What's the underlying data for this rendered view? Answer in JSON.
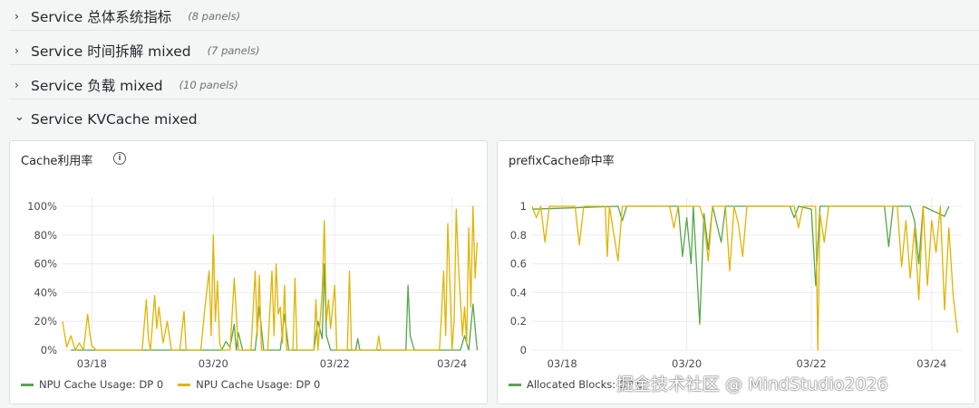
{
  "rows": [
    {
      "title": "Service 总体系统指标",
      "count": "(8 panels)",
      "expanded": false
    },
    {
      "title": "Service 时间拆解 mixed",
      "count": "(7 panels)",
      "expanded": false
    },
    {
      "title": "Service 负载 mixed",
      "count": "(10 panels)",
      "expanded": false
    },
    {
      "title": "Service KVCache mixed",
      "count": "",
      "expanded": true
    }
  ],
  "icons": {
    "collapsed": "chevron-right-icon",
    "expanded": "chevron-down-icon",
    "info": "info-icon"
  },
  "chevrons": {
    "collapsed": "›",
    "expanded": "⌄"
  },
  "colors": {
    "green": "#56a64b",
    "yellow": "#e0b400",
    "grid": "#ececec",
    "axis": "#464c54"
  },
  "panels": [
    {
      "title": "Cache利用率",
      "legend": [
        "NPU Cache Usage: DP 0",
        "NPU Cache Usage: DP 0"
      ]
    },
    {
      "title": "prefixCache命中率",
      "legend": [
        "Allocated Blocks: DP 0"
      ]
    }
  ],
  "chart_data": [
    {
      "type": "line",
      "title": "Cache利用率",
      "x_ticks": [
        "03/18",
        "03/20",
        "03/22",
        "03/24"
      ],
      "y_ticks": [
        "0%",
        "20%",
        "40%",
        "60%",
        "80%",
        "100%"
      ],
      "ylim": [
        0,
        100
      ],
      "grid": true,
      "legend_position": "bottom-left",
      "series": [
        {
          "name": "NPU Cache Usage: DP 0",
          "color": "#56a64b",
          "points": [
            [
              0.02,
              0
            ],
            [
              0.38,
              0
            ],
            [
              0.39,
              6
            ],
            [
              0.4,
              2
            ],
            [
              0.41,
              18
            ],
            [
              0.415,
              0
            ],
            [
              0.42,
              12
            ],
            [
              0.43,
              0
            ],
            [
              0.46,
              0
            ],
            [
              0.47,
              30
            ],
            [
              0.48,
              0
            ],
            [
              0.52,
              0
            ],
            [
              0.53,
              25
            ],
            [
              0.54,
              0
            ],
            [
              0.6,
              0
            ],
            [
              0.61,
              20
            ],
            [
              0.62,
              8
            ],
            [
              0.625,
              60
            ],
            [
              0.63,
              10
            ],
            [
              0.64,
              0
            ],
            [
              0.7,
              0
            ],
            [
              0.705,
              8
            ],
            [
              0.71,
              0
            ],
            [
              0.82,
              0
            ],
            [
              0.825,
              45
            ],
            [
              0.83,
              10
            ],
            [
              0.84,
              0
            ],
            [
              0.95,
              0
            ],
            [
              0.96,
              10
            ],
            [
              0.97,
              0
            ],
            [
              0.98,
              32
            ],
            [
              0.99,
              0
            ]
          ]
        },
        {
          "name": "NPU Cache Usage: DP 0",
          "color": "#e0b400",
          "points": [
            [
              0.0,
              20
            ],
            [
              0.01,
              2
            ],
            [
              0.02,
              10
            ],
            [
              0.03,
              0
            ],
            [
              0.04,
              5
            ],
            [
              0.05,
              0
            ],
            [
              0.06,
              25
            ],
            [
              0.065,
              12
            ],
            [
              0.07,
              3
            ],
            [
              0.08,
              0
            ],
            [
              0.19,
              0
            ],
            [
              0.2,
              35
            ],
            [
              0.205,
              8
            ],
            [
              0.21,
              0
            ],
            [
              0.22,
              38
            ],
            [
              0.225,
              15
            ],
            [
              0.23,
              30
            ],
            [
              0.24,
              5
            ],
            [
              0.25,
              20
            ],
            [
              0.26,
              0
            ],
            [
              0.28,
              0
            ],
            [
              0.29,
              27
            ],
            [
              0.295,
              0
            ],
            [
              0.33,
              0
            ],
            [
              0.34,
              30
            ],
            [
              0.35,
              55
            ],
            [
              0.355,
              10
            ],
            [
              0.36,
              80
            ],
            [
              0.365,
              20
            ],
            [
              0.37,
              48
            ],
            [
              0.375,
              5
            ],
            [
              0.38,
              0
            ],
            [
              0.4,
              0
            ],
            [
              0.41,
              50
            ],
            [
              0.42,
              0
            ],
            [
              0.45,
              0
            ],
            [
              0.46,
              55
            ],
            [
              0.465,
              10
            ],
            [
              0.47,
              52
            ],
            [
              0.475,
              0
            ],
            [
              0.49,
              0
            ],
            [
              0.5,
              55
            ],
            [
              0.505,
              10
            ],
            [
              0.51,
              60
            ],
            [
              0.515,
              25
            ],
            [
              0.52,
              30
            ],
            [
              0.525,
              5
            ],
            [
              0.53,
              45
            ],
            [
              0.535,
              0
            ],
            [
              0.55,
              0
            ],
            [
              0.555,
              50
            ],
            [
              0.56,
              0
            ],
            [
              0.6,
              0
            ],
            [
              0.605,
              35
            ],
            [
              0.61,
              0
            ],
            [
              0.62,
              40
            ],
            [
              0.625,
              90
            ],
            [
              0.63,
              20
            ],
            [
              0.635,
              35
            ],
            [
              0.64,
              15
            ],
            [
              0.65,
              45
            ],
            [
              0.655,
              0
            ],
            [
              0.68,
              0
            ],
            [
              0.685,
              55
            ],
            [
              0.69,
              0
            ],
            [
              0.75,
              0
            ],
            [
              0.755,
              10
            ],
            [
              0.76,
              0
            ],
            [
              0.9,
              0
            ],
            [
              0.905,
              25
            ],
            [
              0.91,
              55
            ],
            [
              0.915,
              10
            ],
            [
              0.92,
              88
            ],
            [
              0.925,
              45
            ],
            [
              0.93,
              0
            ],
            [
              0.935,
              20
            ],
            [
              0.94,
              98
            ],
            [
              0.945,
              60
            ],
            [
              0.95,
              35
            ],
            [
              0.955,
              10
            ],
            [
              0.96,
              30
            ],
            [
              0.965,
              5
            ],
            [
              0.97,
              85
            ],
            [
              0.975,
              30
            ],
            [
              0.98,
              100
            ],
            [
              0.985,
              50
            ],
            [
              0.99,
              75
            ]
          ]
        }
      ]
    },
    {
      "type": "line",
      "title": "prefixCache命中率",
      "x_ticks": [
        "03/18",
        "03/20",
        "03/22",
        "03/24"
      ],
      "y_ticks": [
        "0",
        "0.2",
        "0.4",
        "0.6",
        "0.8",
        "1"
      ],
      "ylim": [
        0,
        1
      ],
      "grid": true,
      "legend_position": "bottom-left",
      "series": [
        {
          "name": "Allocated Blocks: DP 0",
          "color": "#56a64b",
          "points": [
            [
              0.0,
              0.98
            ],
            [
              0.2,
              1.0
            ],
            [
              0.21,
              0.9
            ],
            [
              0.22,
              1.0
            ],
            [
              0.34,
              1.0
            ],
            [
              0.35,
              0.65
            ],
            [
              0.36,
              0.92
            ],
            [
              0.37,
              0.6
            ],
            [
              0.375,
              1.0
            ],
            [
              0.39,
              0.18
            ],
            [
              0.4,
              0.95
            ],
            [
              0.41,
              0.7
            ],
            [
              0.42,
              1.0
            ],
            [
              0.44,
              0.75
            ],
            [
              0.45,
              1.0
            ],
            [
              0.6,
              1.0
            ],
            [
              0.61,
              0.92
            ],
            [
              0.62,
              1.0
            ],
            [
              0.65,
              0.98
            ],
            [
              0.66,
              0.45
            ],
            [
              0.67,
              1.0
            ],
            [
              0.82,
              1.0
            ],
            [
              0.83,
              0.72
            ],
            [
              0.84,
              1.0
            ],
            [
              0.88,
              1.0
            ],
            [
              0.89,
              0.9
            ],
            [
              0.9,
              0.6
            ],
            [
              0.91,
              1.0
            ],
            [
              0.96,
              0.93
            ],
            [
              0.97,
              1.0
            ]
          ]
        },
        {
          "name": "",
          "color": "#e0b400",
          "points": [
            [
              0.0,
              1.0
            ],
            [
              0.01,
              0.92
            ],
            [
              0.02,
              1.0
            ],
            [
              0.03,
              0.75
            ],
            [
              0.04,
              1.0
            ],
            [
              0.1,
              1.0
            ],
            [
              0.11,
              0.73
            ],
            [
              0.12,
              1.0
            ],
            [
              0.17,
              1.0
            ],
            [
              0.175,
              0.65
            ],
            [
              0.18,
              1.0
            ],
            [
              0.2,
              0.62
            ],
            [
              0.21,
              1.0
            ],
            [
              0.32,
              1.0
            ],
            [
              0.33,
              0.85
            ],
            [
              0.34,
              1.0
            ],
            [
              0.39,
              1.0
            ],
            [
              0.4,
              0.9
            ],
            [
              0.41,
              0.62
            ],
            [
              0.42,
              1.0
            ],
            [
              0.45,
              1.0
            ],
            [
              0.46,
              0.55
            ],
            [
              0.47,
              1.0
            ],
            [
              0.48,
              0.88
            ],
            [
              0.49,
              0.65
            ],
            [
              0.5,
              1.0
            ],
            [
              0.61,
              1.0
            ],
            [
              0.62,
              0.85
            ],
            [
              0.63,
              1.0
            ],
            [
              0.66,
              1.0
            ],
            [
              0.665,
              0.0
            ],
            [
              0.67,
              0.95
            ],
            [
              0.68,
              0.75
            ],
            [
              0.69,
              1.0
            ],
            [
              0.85,
              1.0
            ],
            [
              0.86,
              0.58
            ],
            [
              0.87,
              0.9
            ],
            [
              0.88,
              0.5
            ],
            [
              0.89,
              0.85
            ],
            [
              0.9,
              0.35
            ],
            [
              0.91,
              1.0
            ],
            [
              0.92,
              0.45
            ],
            [
              0.93,
              0.9
            ],
            [
              0.94,
              0.68
            ],
            [
              0.95,
              1.0
            ],
            [
              0.96,
              0.28
            ],
            [
              0.97,
              0.85
            ],
            [
              0.98,
              0.38
            ],
            [
              0.99,
              0.12
            ]
          ]
        }
      ]
    }
  ],
  "watermark": "掘金技术社区 @ MindStudio2026"
}
